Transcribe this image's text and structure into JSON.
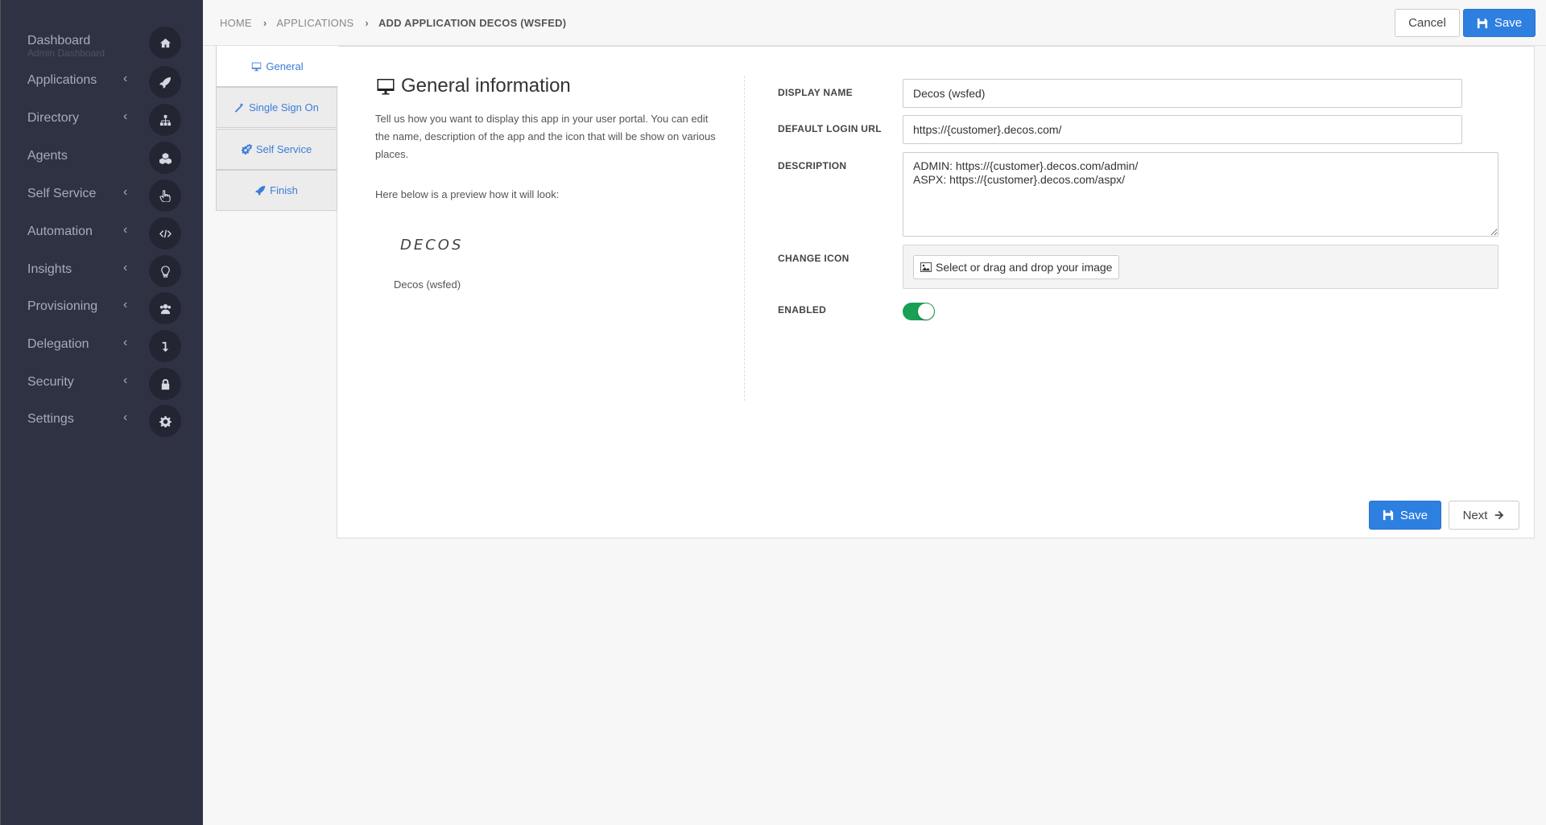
{
  "sidebar": {
    "items": [
      {
        "label": "Dashboard",
        "sublabel": "Admin Dashboard",
        "icon": "home-icon"
      },
      {
        "label": "Applications",
        "chevron": "‹",
        "icon": "rocket-icon"
      },
      {
        "label": "Directory",
        "chevron": "‹",
        "icon": "sitemap-icon"
      },
      {
        "label": "Agents",
        "icon": "cubes-icon"
      },
      {
        "label": "Self Service",
        "chevron": "‹",
        "icon": "hand-pointer-icon"
      },
      {
        "label": "Automation",
        "chevron": "‹",
        "icon": "code-icon"
      },
      {
        "label": "Insights",
        "chevron": "‹",
        "icon": "lightbulb-icon"
      },
      {
        "label": "Provisioning",
        "chevron": "‹",
        "icon": "users-icon"
      },
      {
        "label": "Delegation",
        "chevron": "‹",
        "icon": "level-down-icon"
      },
      {
        "label": "Security",
        "chevron": "‹",
        "icon": "lock-icon"
      },
      {
        "label": "Settings",
        "chevron": "‹",
        "icon": "gear-icon"
      }
    ]
  },
  "breadcrumb": {
    "home": "HOME",
    "applications": "APPLICATIONS",
    "current": "ADD APPLICATION DECOS (WSFED)",
    "separator": "›"
  },
  "header": {
    "cancel_label": "Cancel",
    "save_label": "Save"
  },
  "tabs": [
    {
      "label": "General",
      "icon": "desktop-icon"
    },
    {
      "label": "Single Sign On",
      "icon": "magic-icon"
    },
    {
      "label": "Self Service",
      "icon": "cogs-icon"
    },
    {
      "label": "Finish",
      "icon": "rocket-icon"
    }
  ],
  "info": {
    "title": "General information",
    "description": "Tell us how you want to display this app in your user portal. You can edit the name, description of the app and the icon that will be show on various places.",
    "preview_label": "Here below is a preview how it will look:",
    "logo_text": "DECOS",
    "app_name": "Decos (wsfed)"
  },
  "form": {
    "display_name_label": "DISPLAY NAME",
    "display_name_value": "Decos (wsfed)",
    "login_url_label": "DEFAULT LOGIN URL",
    "login_url_value": "https://{customer}.decos.com/",
    "description_label": "DESCRIPTION",
    "description_value": "ADMIN: https://{customer}.decos.com/admin/\nASPX: https://{customer}.decos.com/aspx/",
    "change_icon_label": "CHANGE ICON",
    "select_image_label": "Select or drag and drop your image",
    "enabled_label": "ENABLED",
    "enabled": true
  },
  "footer": {
    "save_label": "Save",
    "next_label": "Next"
  },
  "colors": {
    "sidebar_bg": "#2f3243",
    "primary": "#2d7fe0",
    "toggle_on": "#1aa052"
  }
}
